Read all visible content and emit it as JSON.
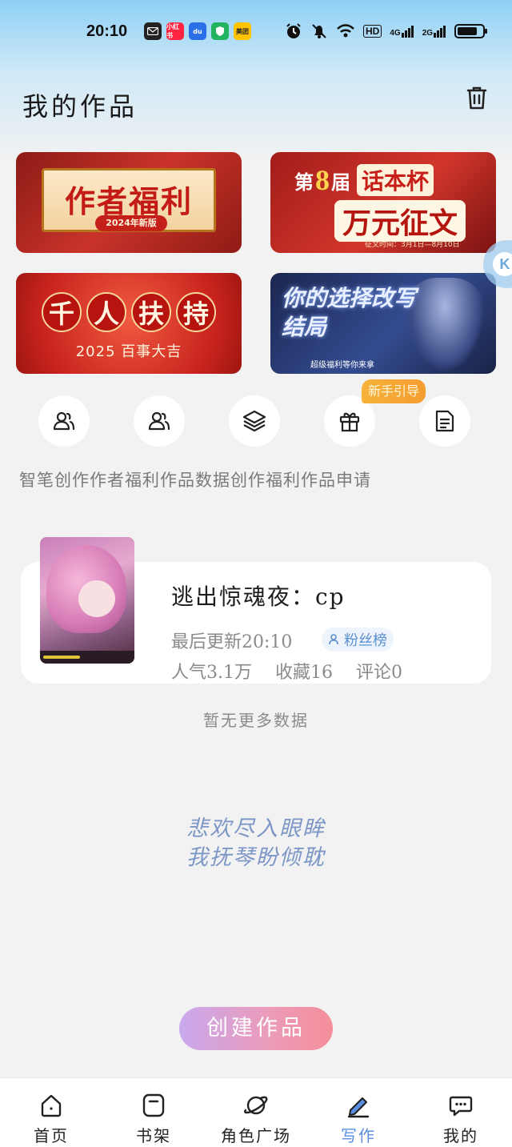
{
  "status_bar": {
    "time": "20:10",
    "notification_apps": [
      {
        "icon": "message-app-icon",
        "label": "",
        "color": "#222"
      },
      {
        "icon": "xiaohongshu-app-icon",
        "label": "小红书",
        "color": "#ff2442"
      },
      {
        "icon": "baidu-app-icon",
        "label": "du",
        "color": "#2a6ee8"
      },
      {
        "icon": "shield-app-icon",
        "label": "",
        "color": "#22b35e"
      },
      {
        "icon": "meituan-app-icon",
        "label": "美团",
        "color": "#ffc300"
      }
    ],
    "hd_label": "HD",
    "net_4g": "4G",
    "net_2g": "2G",
    "battery_level": 0.8
  },
  "header": {
    "title": "我的作品"
  },
  "banners": {
    "b1": {
      "title": "作者福利",
      "subtitle": "2024年新版"
    },
    "b2": {
      "prefix": "第",
      "number": "8",
      "suffix": "届",
      "cup": "话本杯",
      "main": "万元征文",
      "date": "征文时间：3月1日—8月10日"
    },
    "b3": {
      "chars": [
        "千",
        "人",
        "扶",
        "持"
      ],
      "subtitle": "2025 百事大吉"
    },
    "b4": {
      "title": "你的选择改写结局",
      "subtitle": "超级福利等你来拿"
    }
  },
  "float_handle": "K",
  "quick_links": {
    "guide_badge": "新手引导",
    "labels": "智笔创作作者福利作品数据创作福利作品申请"
  },
  "work": {
    "title": "逃出惊魂夜：cp",
    "updated": "最后更新20:10",
    "fans_badge": "粉丝榜",
    "popularity": "人气3.1万",
    "favorites": "收藏16",
    "comments": "评论0"
  },
  "no_more": "暂无更多数据",
  "quote": [
    "悲欢尽入眼眸",
    "我抚琴盼倾耽"
  ],
  "create_button": "创建作品",
  "nav": [
    {
      "label": "首页",
      "icon": "home-icon"
    },
    {
      "label": "书架",
      "icon": "bookshelf-icon"
    },
    {
      "label": "角色广场",
      "icon": "planet-icon"
    },
    {
      "label": "写作",
      "icon": "pen-icon",
      "active": true
    },
    {
      "label": "我的",
      "icon": "chat-bubble-icon"
    }
  ],
  "colors": {
    "accent": "#5a8fe0",
    "quote": "#7d97c6",
    "badge": "#f7b23b"
  }
}
